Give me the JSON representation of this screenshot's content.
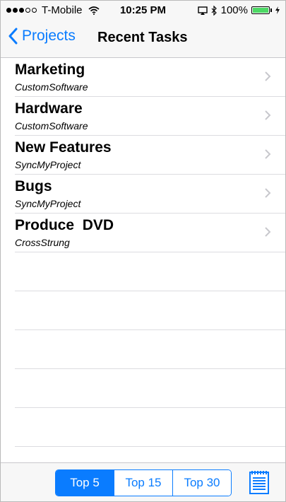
{
  "status_bar": {
    "carrier": "T-Mobile",
    "time": "10:25 PM",
    "battery": "100%",
    "signal_filled": 3,
    "signal_total": 5,
    "icons": [
      "wifi-icon",
      "airplay-icon",
      "bluetooth-icon",
      "battery-icon",
      "charging-bolt-icon"
    ]
  },
  "nav": {
    "back_label": "Projects",
    "title": "Recent Tasks"
  },
  "tasks": [
    {
      "title": "Marketing",
      "subtitle": "CustomSoftware"
    },
    {
      "title": "Hardware",
      "subtitle": "CustomSoftware"
    },
    {
      "title": "New Features",
      "subtitle": "SyncMyProject"
    },
    {
      "title": "Bugs",
      "subtitle": "SyncMyProject"
    },
    {
      "title": "Produce  DVD",
      "subtitle": "CrossStrung"
    }
  ],
  "toolbar": {
    "segments": [
      "Top 5",
      "Top 15",
      "Top 30"
    ],
    "selected": "Top 5"
  },
  "colors": {
    "accent": "#0a7cff",
    "battery": "#4cd964",
    "separator": "#dcdce0"
  }
}
